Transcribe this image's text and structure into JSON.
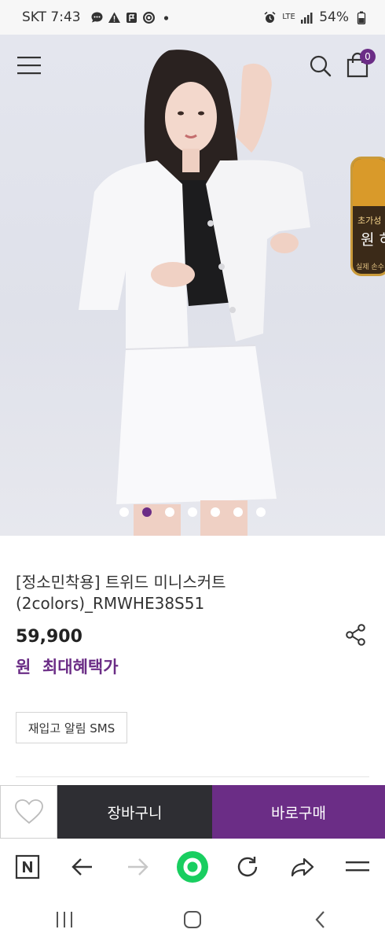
{
  "status_bar": {
    "carrier_time": "SKT 7:43",
    "network": "LTE",
    "battery": "54%",
    "icons": [
      "message-icon",
      "alert-icon",
      "flag-icon",
      "target-icon",
      "dot-icon",
      "alarm-icon",
      "signal-icon",
      "battery-icon"
    ]
  },
  "header": {
    "icons": [
      "menu-icon",
      "search-icon",
      "shopping-bag-icon"
    ],
    "cart_count": "0"
  },
  "side_banner": {
    "line1": "초가성",
    "line2": "원 혀",
    "line3": "실제 손수"
  },
  "carousel": {
    "total": 7,
    "active_index": 1
  },
  "product": {
    "title_line1": "[정소민착용] 트위드 미니스커트",
    "title_line2": "(2colors)_RMWHE38S51",
    "price": "59,900",
    "benefit_label": "원  최대혜택가",
    "restock_label": "재입고 알림 SMS"
  },
  "purchase_bar": {
    "cart_label": "장바구니",
    "buy_label": "바로구매"
  },
  "browser_bar": {
    "icons": [
      "naver-n-icon",
      "back-arrow-icon",
      "forward-arrow-icon",
      "green-circle-icon",
      "refresh-icon",
      "share-arrow-icon",
      "menu-lines-icon"
    ]
  },
  "system_nav": {
    "icons": [
      "recent-apps-icon",
      "home-icon",
      "back-icon"
    ]
  },
  "colors": {
    "brand_purple": "#6b2d86",
    "dark_button": "#2e2e33",
    "green": "#19ce60"
  }
}
